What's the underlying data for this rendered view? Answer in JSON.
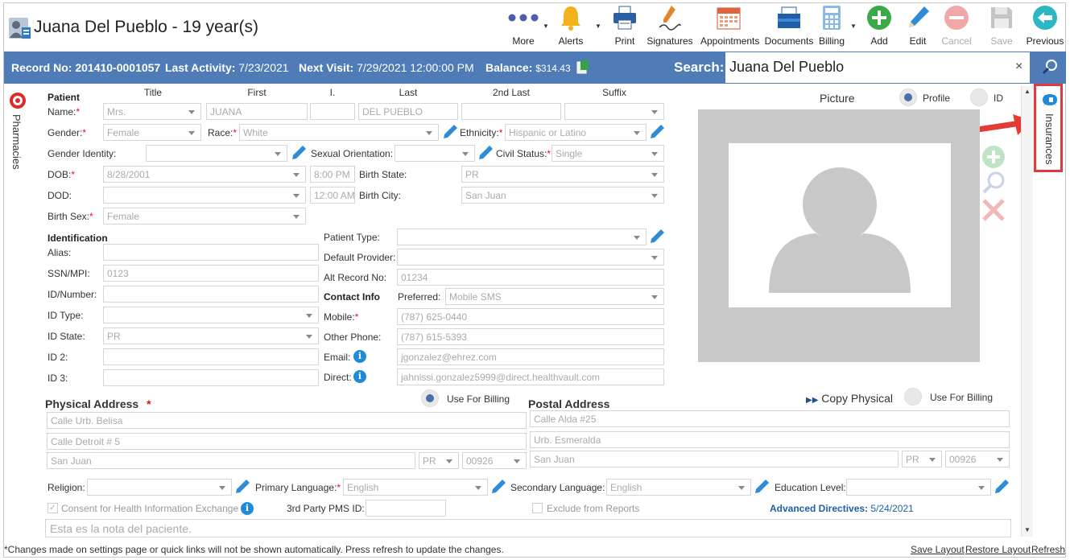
{
  "header": {
    "title": "Juana Del Pueblo - 19 year(s)",
    "toolbar": [
      {
        "label": "More",
        "icon": "more-dots-icon"
      },
      {
        "label": "Alerts",
        "icon": "bell-icon"
      },
      {
        "label": "Print",
        "icon": "printer-icon"
      },
      {
        "label": "Signatures",
        "icon": "pen-signature-icon"
      },
      {
        "label": "Appointments",
        "icon": "calendar-icon"
      },
      {
        "label": "Documents",
        "icon": "folder-tray-icon"
      },
      {
        "label": "Billing",
        "icon": "calculator-icon"
      },
      {
        "label": "Add",
        "icon": "plus-circle-icon"
      },
      {
        "label": "Edit",
        "icon": "pencil-icon"
      },
      {
        "label": "Cancel",
        "icon": "cancel-circle-icon"
      },
      {
        "label": "Save",
        "icon": "floppy-disk-icon"
      },
      {
        "label": "Previous",
        "icon": "back-arrow-icon"
      }
    ]
  },
  "record_bar": {
    "record_label": "Record No:",
    "record_value": "201410-0001057",
    "activity_label": "Last Activity:",
    "activity_value": "7/23/2021",
    "visit_label": "Next Visit:",
    "visit_value": "7/29/2021 12:00:00 PM",
    "balance_label": "Balance:",
    "balance_value": "$314.43",
    "search_label": "Search:",
    "search_value": "Juana Del Pueblo",
    "clear": "×"
  },
  "side": {
    "pharmacies": "Pharmacies",
    "insurances": "Insurances"
  },
  "patient": {
    "section": "Patient",
    "columns": {
      "title": "Title",
      "first": "First",
      "initial": "I.",
      "last": "Last",
      "second_last": "2nd Last",
      "suffix": "Suffix"
    },
    "name_label": "Name:",
    "title_value": "Mrs.",
    "first_value": "JUANA",
    "initial_value": "",
    "last_value": "DEL PUEBLO",
    "second_last_value": "",
    "suffix_value": "",
    "gender_label": "Gender:",
    "gender_value": "Female",
    "race_label": "Race:",
    "race_value": "White",
    "ethnicity_label": "Ethnicity:",
    "ethnicity_value": "Hispanic or Latino",
    "gender_identity_label": "Gender Identity:",
    "gender_identity_value": "",
    "sexual_orientation_label": "Sexual Orientation:",
    "sexual_orientation_value": "",
    "civil_status_label": "Civil Status:",
    "civil_status_value": "Single",
    "dob_label": "DOB:",
    "dob_value": "8/28/2001",
    "dob_time": "8:00 PM",
    "birth_state_label": "Birth State:",
    "birth_state_value": "PR",
    "dod_label": "DOD:",
    "dod_value": "",
    "dod_time": "12:00 AM",
    "birth_city_label": "Birth City:",
    "birth_city_value": "San Juan",
    "birth_sex_label": "Birth Sex:",
    "birth_sex_value": "Female"
  },
  "identification": {
    "section": "Identification",
    "alias_label": "Alias:",
    "alias_value": "",
    "ssn_label": "SSN/MPI:",
    "ssn_value": "0123",
    "idnum_label": "ID/Number:",
    "idnum_value": "",
    "idtype_label": "ID Type:",
    "idtype_value": "",
    "idstate_label": "ID State:",
    "idstate_value": "PR",
    "id2_label": "ID 2:",
    "id2_value": "",
    "id3_label": "ID 3:",
    "id3_value": ""
  },
  "patient_info": {
    "patient_type_label": "Patient Type:",
    "patient_type_value": "",
    "default_provider_label": "Default Provider:",
    "default_provider_value": "",
    "alt_record_label": "Alt Record No:",
    "alt_record_value": "01234"
  },
  "contact": {
    "section": "Contact Info",
    "preferred_label": "Preferred:",
    "preferred_value": "Mobile SMS",
    "mobile_label": "Mobile:",
    "mobile_value": "(787) 625-0440",
    "other_phone_label": "Other Phone:",
    "other_phone_value": "(787) 615-5393",
    "email_label": "Email:",
    "email_value": "jgonzalez@ehrez.com",
    "direct_label": "Direct:",
    "direct_value": "jahnissi.gonzalez5999@direct.healthvault.com"
  },
  "picture": {
    "label": "Picture",
    "profile": "Profile",
    "id": "ID"
  },
  "physical_address": {
    "section": "Physical Address",
    "use_billing": "Use For Billing",
    "line1": "Calle Urb. Belisa",
    "line2": "Calle Detroit # 5",
    "city": "San Juan",
    "state": "PR",
    "zip": "00926"
  },
  "postal_address": {
    "section": "Postal Address",
    "copy": "Copy Physical",
    "use_billing": "Use For Billing",
    "line1": "Calle Alda #25",
    "line2": "Urb. Esmeralda",
    "city": "San Juan",
    "state": "PR",
    "zip": "00926"
  },
  "other": {
    "religion_label": "Religion:",
    "religion_value": "",
    "primary_language_label": "Primary Language:",
    "primary_language_value": "English",
    "secondary_language_label": "Secondary Language:",
    "secondary_language_value": "English",
    "education_label": "Education Level:",
    "education_value": "",
    "consent_label": "Consent for Health Information Exchange",
    "third_party_label": "3rd Party PMS ID:",
    "third_party_value": "",
    "exclude_label": "Exclude from Reports",
    "advanced_label": "Advanced Directives:",
    "advanced_value": "5/24/2021",
    "notes": "Esta es la nota del paciente."
  },
  "footer": {
    "message": "*Changes made on settings page or quick links will not be shown automatically. Press refresh to update the changes.",
    "save_layout": "Save Layout",
    "restore_layout": "Restore Layout",
    "refresh": "Refresh"
  },
  "colors": {
    "bar": "#4f7cb6",
    "accent": "#1e8bd8",
    "required": "#dd1122",
    "highlight": "#e03a3e"
  }
}
